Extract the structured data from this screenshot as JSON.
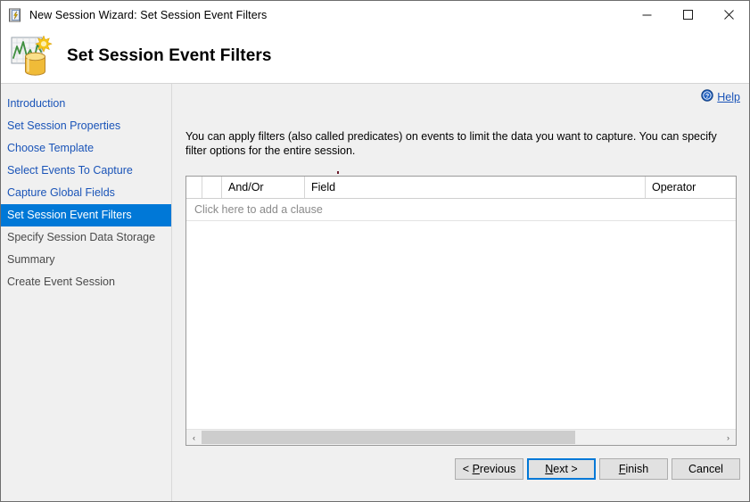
{
  "window": {
    "title": "New Session Wizard: Set Session Event Filters",
    "icon": "wizard-document-icon",
    "controls": {
      "minimize": "—",
      "maximize": "□",
      "close": "✕"
    }
  },
  "header": {
    "title": "Set Session Event Filters",
    "icon": "xevent-session-chart-icon"
  },
  "sidebar": {
    "items": [
      {
        "label": "Introduction",
        "state": "link"
      },
      {
        "label": "Set Session Properties",
        "state": "link"
      },
      {
        "label": "Choose Template",
        "state": "link"
      },
      {
        "label": "Select Events To Capture",
        "state": "link"
      },
      {
        "label": "Capture Global Fields",
        "state": "link"
      },
      {
        "label": "Set Session Event Filters",
        "state": "active"
      },
      {
        "label": "Specify Session Data Storage",
        "state": "disabled"
      },
      {
        "label": "Summary",
        "state": "disabled"
      },
      {
        "label": "Create Event Session",
        "state": "disabled"
      }
    ]
  },
  "content": {
    "help_label": "Help",
    "help_icon": "help-circle-icon",
    "description": "You can apply filters (also called predicates) on events to limit the data you want to capture. You can specify filter options for the entire session."
  },
  "grid": {
    "columns": [
      {
        "label": ""
      },
      {
        "label": ""
      },
      {
        "label": "And/Or"
      },
      {
        "label": "Field"
      },
      {
        "label": "Operator"
      }
    ],
    "add_clause_row": "Click here to add a clause",
    "rows": [],
    "scrollbar": {
      "left_arrow": "‹",
      "right_arrow": "›",
      "thumb_fraction": 0.72
    }
  },
  "footer": {
    "previous": {
      "pre": "< ",
      "accel": "P",
      "post": "revious"
    },
    "next": {
      "pre": "",
      "accel": "N",
      "post": "ext >"
    },
    "finish": {
      "pre": "",
      "accel": "F",
      "post": "inish"
    },
    "cancel": {
      "pre": "",
      "accel": "",
      "post": "Cancel"
    }
  },
  "colors": {
    "accent": "#0078d7",
    "link": "#1a54b8",
    "body_bg": "#f0f0f0",
    "grid_bg": "#ffffff",
    "placeholder_text": "#8a8a8a"
  }
}
